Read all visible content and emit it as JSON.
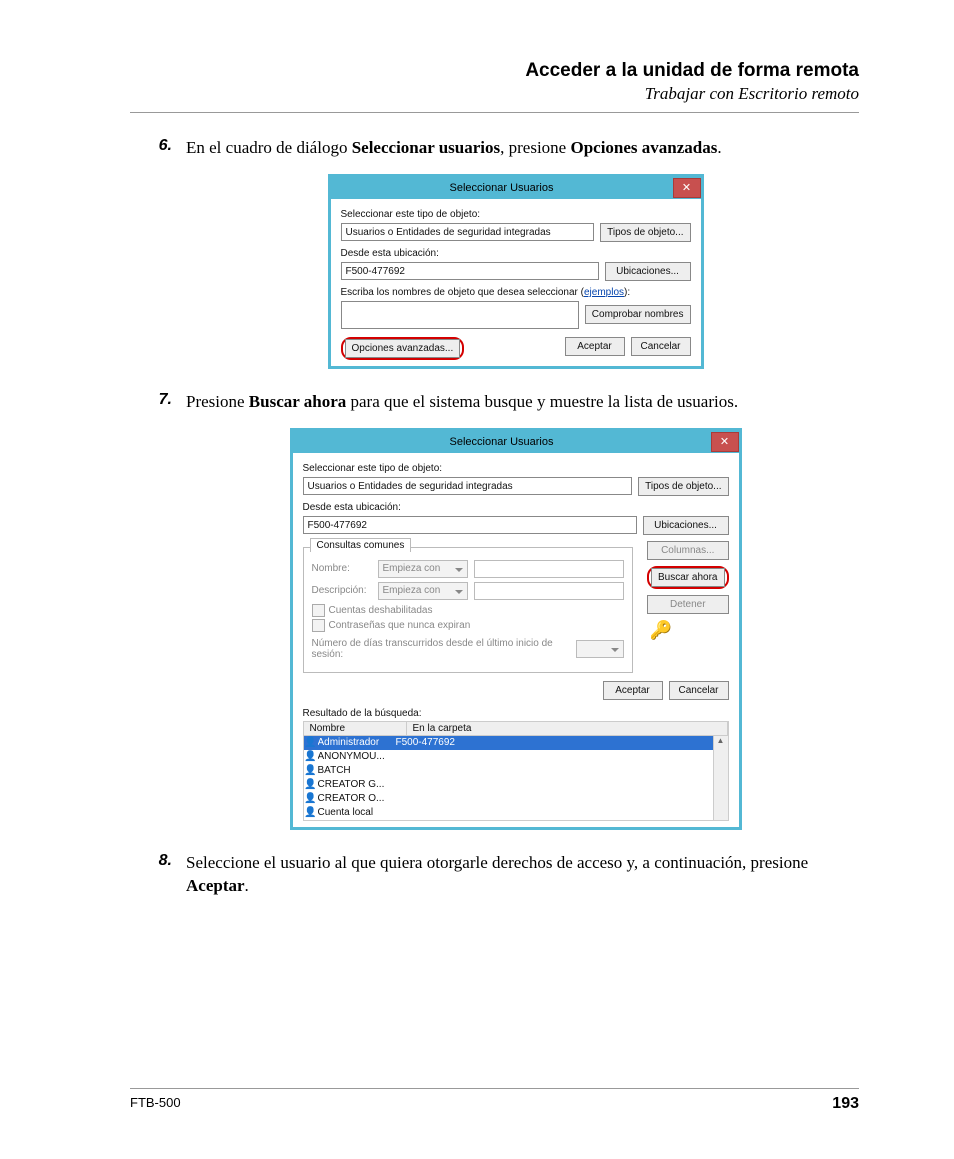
{
  "header": {
    "title": "Acceder a la unidad de forma remota",
    "subtitle": "Trabajar con Escritorio remoto"
  },
  "steps": {
    "s6": {
      "num": "6.",
      "pre": "En el cuadro de diálogo ",
      "b1": "Seleccionar usuarios",
      "mid": ", presione ",
      "b2": "Opciones avanzadas",
      "post": "."
    },
    "s7": {
      "num": "7.",
      "pre": "Presione ",
      "b1": "Buscar ahora",
      "post": " para que el sistema busque y muestre la lista de usuarios."
    },
    "s8": {
      "num": "8.",
      "pre": "Seleccione el usuario al que quiera otorgarle derechos de acceso y, a continuación, presione ",
      "b1": "Aceptar",
      "post": "."
    }
  },
  "dlg1": {
    "title": "Seleccionar Usuarios",
    "obj_label": "Seleccionar este tipo de objeto:",
    "obj_value": "Usuarios o Entidades de seguridad integradas",
    "btn_types": "Tipos de objeto...",
    "loc_label": "Desde esta ubicación:",
    "loc_value": "F500-477692",
    "btn_loc": "Ubicaciones...",
    "names_label_a": "Escriba los nombres de objeto que desea seleccionar (",
    "names_label_link": "ejemplos",
    "names_label_b": "):",
    "btn_check": "Comprobar nombres",
    "btn_adv": "Opciones avanzadas...",
    "btn_ok": "Aceptar",
    "btn_cancel": "Cancelar"
  },
  "dlg2": {
    "title": "Seleccionar Usuarios",
    "obj_label": "Seleccionar este tipo de objeto:",
    "obj_value": "Usuarios o Entidades de seguridad integradas",
    "btn_types": "Tipos de objeto...",
    "loc_label": "Desde esta ubicación:",
    "loc_value": "F500-477692",
    "btn_loc": "Ubicaciones...",
    "tab": "Consultas comunes",
    "name_lbl": "Nombre:",
    "desc_lbl": "Descripción:",
    "starts": "Empieza con",
    "chk1": "Cuentas deshabilitadas",
    "chk2": "Contraseñas que nunca expiran",
    "days": "Número de días transcurridos desde el último inicio de sesión:",
    "btn_cols": "Columnas...",
    "btn_find": "Buscar ahora",
    "btn_stop": "Detener",
    "btn_ok": "Aceptar",
    "btn_cancel": "Cancelar",
    "res_label": "Resultado de la búsqueda:",
    "col1": "Nombre",
    "col2": "En la carpeta",
    "rows": [
      {
        "name": "Administrador",
        "folder": "F500-477692",
        "sel": true
      },
      {
        "name": "ANONYMOU...",
        "folder": "",
        "sel": false
      },
      {
        "name": "BATCH",
        "folder": "",
        "sel": false
      },
      {
        "name": "CREATOR G...",
        "folder": "",
        "sel": false
      },
      {
        "name": "CREATOR O...",
        "folder": "",
        "sel": false
      },
      {
        "name": "Cuenta local",
        "folder": "",
        "sel": false
      }
    ]
  },
  "footer": {
    "left": "FTB-500",
    "right": "193"
  }
}
